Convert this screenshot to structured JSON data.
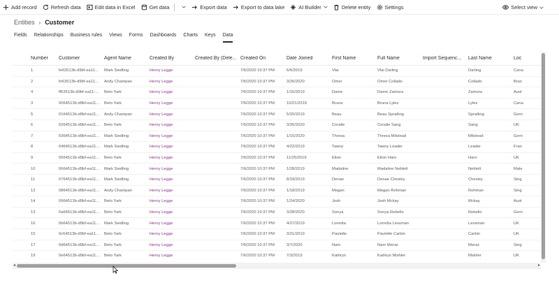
{
  "commandbar": {
    "add_record": "Add record",
    "refresh_data": "Refresh data",
    "edit_excel": "Edit data in Excel",
    "get_data": "Get data",
    "export_data": "Export data",
    "export_lake": "Export to data lake",
    "ai_builder": "AI Builder",
    "delete_entity": "Delete entity",
    "settings": "Settings",
    "select_view": "Select view"
  },
  "breadcrumb": {
    "root": "Entities",
    "separator": "›",
    "current": "Customer"
  },
  "tabs": [
    "Fields",
    "Relationships",
    "Business rules",
    "Views",
    "Forms",
    "Dashboards",
    "Charts",
    "Keys",
    "Data"
  ],
  "active_tab": "Data",
  "grid": {
    "columns": [
      "Number",
      "Customer",
      "Agent Name",
      "Created By",
      "Created By (Dele...",
      "Created On",
      "Date Joined",
      "First Name",
      "Full Name",
      "Import Sequenc...",
      "Last Name",
      "Loc"
    ],
    "rows": [
      [
        "1",
        "fe63513b-d9bf-ea11...",
        "Mark Siedling",
        "Henry Legge",
        "",
        "7/6/2020 10:37 PM",
        "6/6/2019",
        "Vlai",
        "Vlai Darling",
        "",
        "Darling",
        "Cana"
      ],
      [
        "2",
        "fe63513b-d9bf-ea11...",
        "Andy Champan",
        "Henry Legge",
        "",
        "7/6/2020 10:37 PM",
        "3/26/2020",
        "Omer",
        "Omer Collado",
        "",
        "Collado",
        "Braz"
      ],
      [
        "4",
        "ff63513b-d9bf-ea11-...",
        "Beto Yark",
        "Henry Legge",
        "",
        "7/6/2020 10:37 PM",
        "1/16/2019",
        "Dame",
        "Dame Zamora",
        "",
        "Zamora",
        "Aust"
      ],
      [
        "3",
        "0064513b-d9bf-ea11...",
        "Beto Yark",
        "Henry Legge",
        "",
        "7/6/2020 10:37 PM",
        "10/21/2019",
        "Bruna",
        "Bruna Lyles",
        "",
        "Lyles",
        "Cana"
      ],
      [
        "5",
        "0164513b-d9bf-ea11...",
        "Andy Champan",
        "Henry Legge",
        "",
        "7/6/2020 10:37 PM",
        "5/20/2019",
        "Beau",
        "Beau Spratling",
        "",
        "Spratling",
        "Gern"
      ],
      [
        "6",
        "0264513b-d9bf-ea11...",
        "Beto Yark",
        "Henry Legge",
        "",
        "7/6/2020 10:37 PM",
        "3/26/2020",
        "Coralie",
        "Coralie Sang",
        "",
        "Sang",
        "UK"
      ],
      [
        "7",
        "0364513b-d9bf-ea11...",
        "Mark Siedling",
        "Henry Legge",
        "",
        "7/6/2020 10:37 PM",
        "1/15/2020",
        "Thresa",
        "Thresa Milstead",
        "",
        "Milstead",
        "Gern"
      ],
      [
        "8",
        "0464513b-d9bf-ea11...",
        "Mark Siedling",
        "Henry Legge",
        "",
        "7/6/2020 10:37 PM",
        "4/22/2019",
        "Tawny",
        "Tawny Leader",
        "",
        "Leader",
        "Fran"
      ],
      [
        "9",
        "0564513b-d9bf-ea11...",
        "Beto Yark",
        "Henry Legge",
        "",
        "7/6/2020 10:37 PM",
        "11/25/2019",
        "Elton",
        "Elton Haro",
        "",
        "Haro",
        "UK"
      ],
      [
        "10",
        "0664513b-d9bf-ea11...",
        "Mark Siedling",
        "Henry Legge",
        "",
        "7/6/2020 10:37 PM",
        "1/28/2019",
        "Madaline",
        "Madaline Neblett",
        "",
        "Neblett",
        "Male"
      ],
      [
        "11",
        "0764513b-d9bf-ea11...",
        "Mark Siedling",
        "Henry Legge",
        "",
        "7/6/2020 10:37 PM",
        "8/18/2019",
        "Denae",
        "Denae Chesley",
        "",
        "Chesley",
        "Sing"
      ],
      [
        "12",
        "0864513b-d9bf-ea11...",
        "Andy Champan",
        "Henry Legge",
        "",
        "7/6/2020 10:37 PM",
        "1/18/2019",
        "Megan",
        "Megan Rohman",
        "",
        "Rohman",
        "Sing"
      ],
      [
        "14",
        "0964513b-d9bf-ea11...",
        "Beto Yark",
        "Henry Legge",
        "",
        "7/6/2020 10:37 PM",
        "1/24/2020",
        "Josh",
        "Josh Mckay",
        "",
        "Mckay",
        "Aust"
      ],
      [
        "13",
        "0a64513b-d9bf-ea11...",
        "Beto Yark",
        "Henry Legge",
        "",
        "7/6/2020 10:37 PM",
        "3/28/2020",
        "Sonya",
        "Sonya Rebello",
        "",
        "Rebello",
        "Gern"
      ],
      [
        "16",
        "0b64513b-d9bf-ea11...",
        "Mark Siedling",
        "Henry Legge",
        "",
        "7/6/2020 10:37 PM",
        "4/27/2019",
        "Lorretta",
        "Lorretta Lessman",
        "",
        "Lessman",
        "UK"
      ],
      [
        "15",
        "0c64513b-d9bf-ea11...",
        "Beto Yark",
        "Henry Legge",
        "",
        "7/6/2020 10:37 PM",
        "3/21/2019",
        "Paulette",
        "Paulette Carbin",
        "",
        "Carbin",
        "UK"
      ],
      [
        "17",
        "0d64513b-d9bf-ea11...",
        "Beto Yark",
        "Henry Legge",
        "",
        "7/6/2020 10:37 PM",
        "3/7/2020",
        "Nam",
        "Nam Meraz",
        "",
        "Meraz",
        "Sing"
      ],
      [
        "19",
        "0e64513b-d9bf-ea11...",
        "Beto Yark",
        "Henry Legge",
        "",
        "7/6/2020 10:37 PM",
        "7/3/2019",
        "Kathryn",
        "Kathryn Mishler",
        "",
        "Mishler",
        "UK"
      ]
    ]
  },
  "colors": {
    "link": "#8a3c8a",
    "text": "#323130",
    "muted": "#605e5c",
    "border": "#edebe9"
  }
}
